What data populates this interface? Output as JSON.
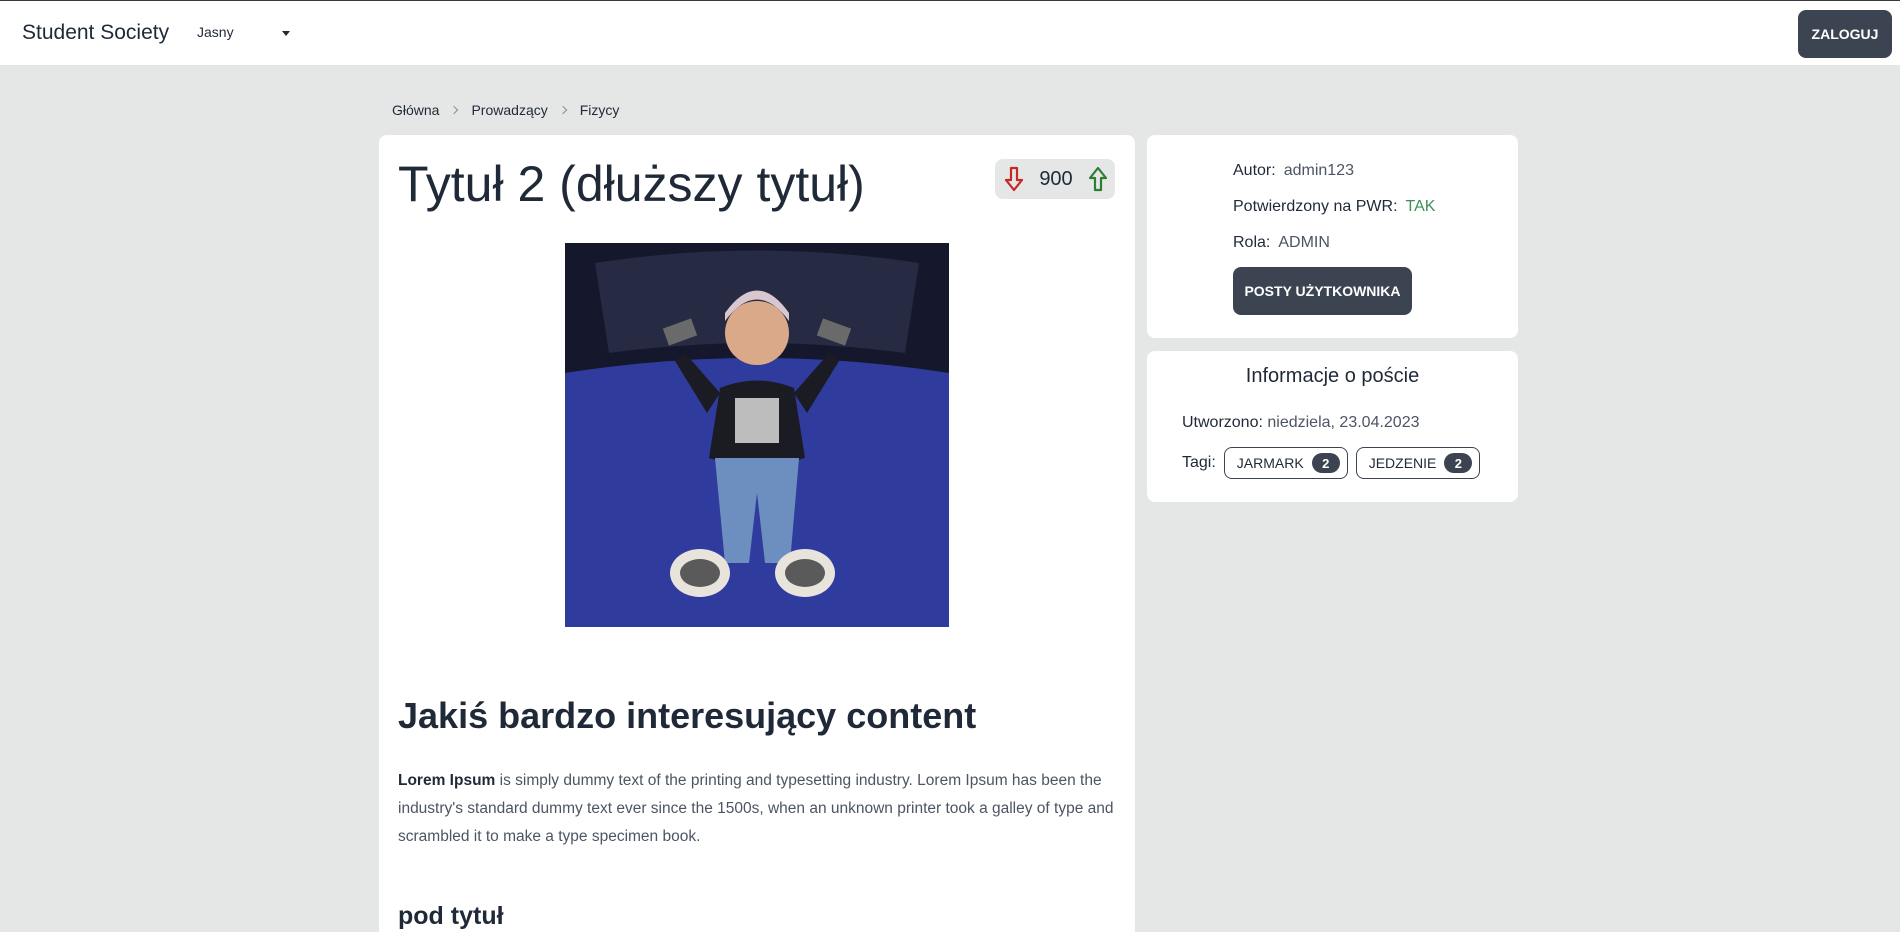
{
  "navbar": {
    "brand": "Student Society",
    "theme_selected": "Jasny",
    "login_label": "ZALOGUJ"
  },
  "breadcrumb": [
    "Główna",
    "Prowadzący",
    "Fizycy"
  ],
  "post": {
    "title": "Tytuł 2 (dłuższy tytuł)",
    "votes": "900",
    "content_heading": "Jakiś bardzo interesujący content",
    "para_bold": "Lorem Ipsum",
    "para_rest": " is simply dummy text of the printing and typesetting industry. Lorem Ipsum has been the industry's standard dummy text ever since the 1500s, when an unknown printer took a galley of type and scrambled it to make a type specimen book.",
    "subheading": "pod tytuł"
  },
  "author": {
    "author_label": "Autor:",
    "author_value": "admin123",
    "confirmed_label": "Potwierdzony na PWR:",
    "confirmed_value": "TAK",
    "role_label": "Rola:",
    "role_value": "ADMIN",
    "posts_button": "POSTY UŻYTKOWNIKA"
  },
  "post_info": {
    "title": "Informacje o poście",
    "created_label": "Utworzono:",
    "created_value": "niedziela, 23.04.2023",
    "tags_label": "Tagi:",
    "tags": [
      {
        "name": "JARMARK",
        "count": "2"
      },
      {
        "name": "JEDZENIE",
        "count": "2"
      }
    ]
  },
  "colors": {
    "accent_dark": "#3d4451",
    "downvote": "#c62828",
    "upvote": "#2e7d32",
    "confirmed_green": "#3f8f5a",
    "page_bg": "#e5e6e6"
  }
}
